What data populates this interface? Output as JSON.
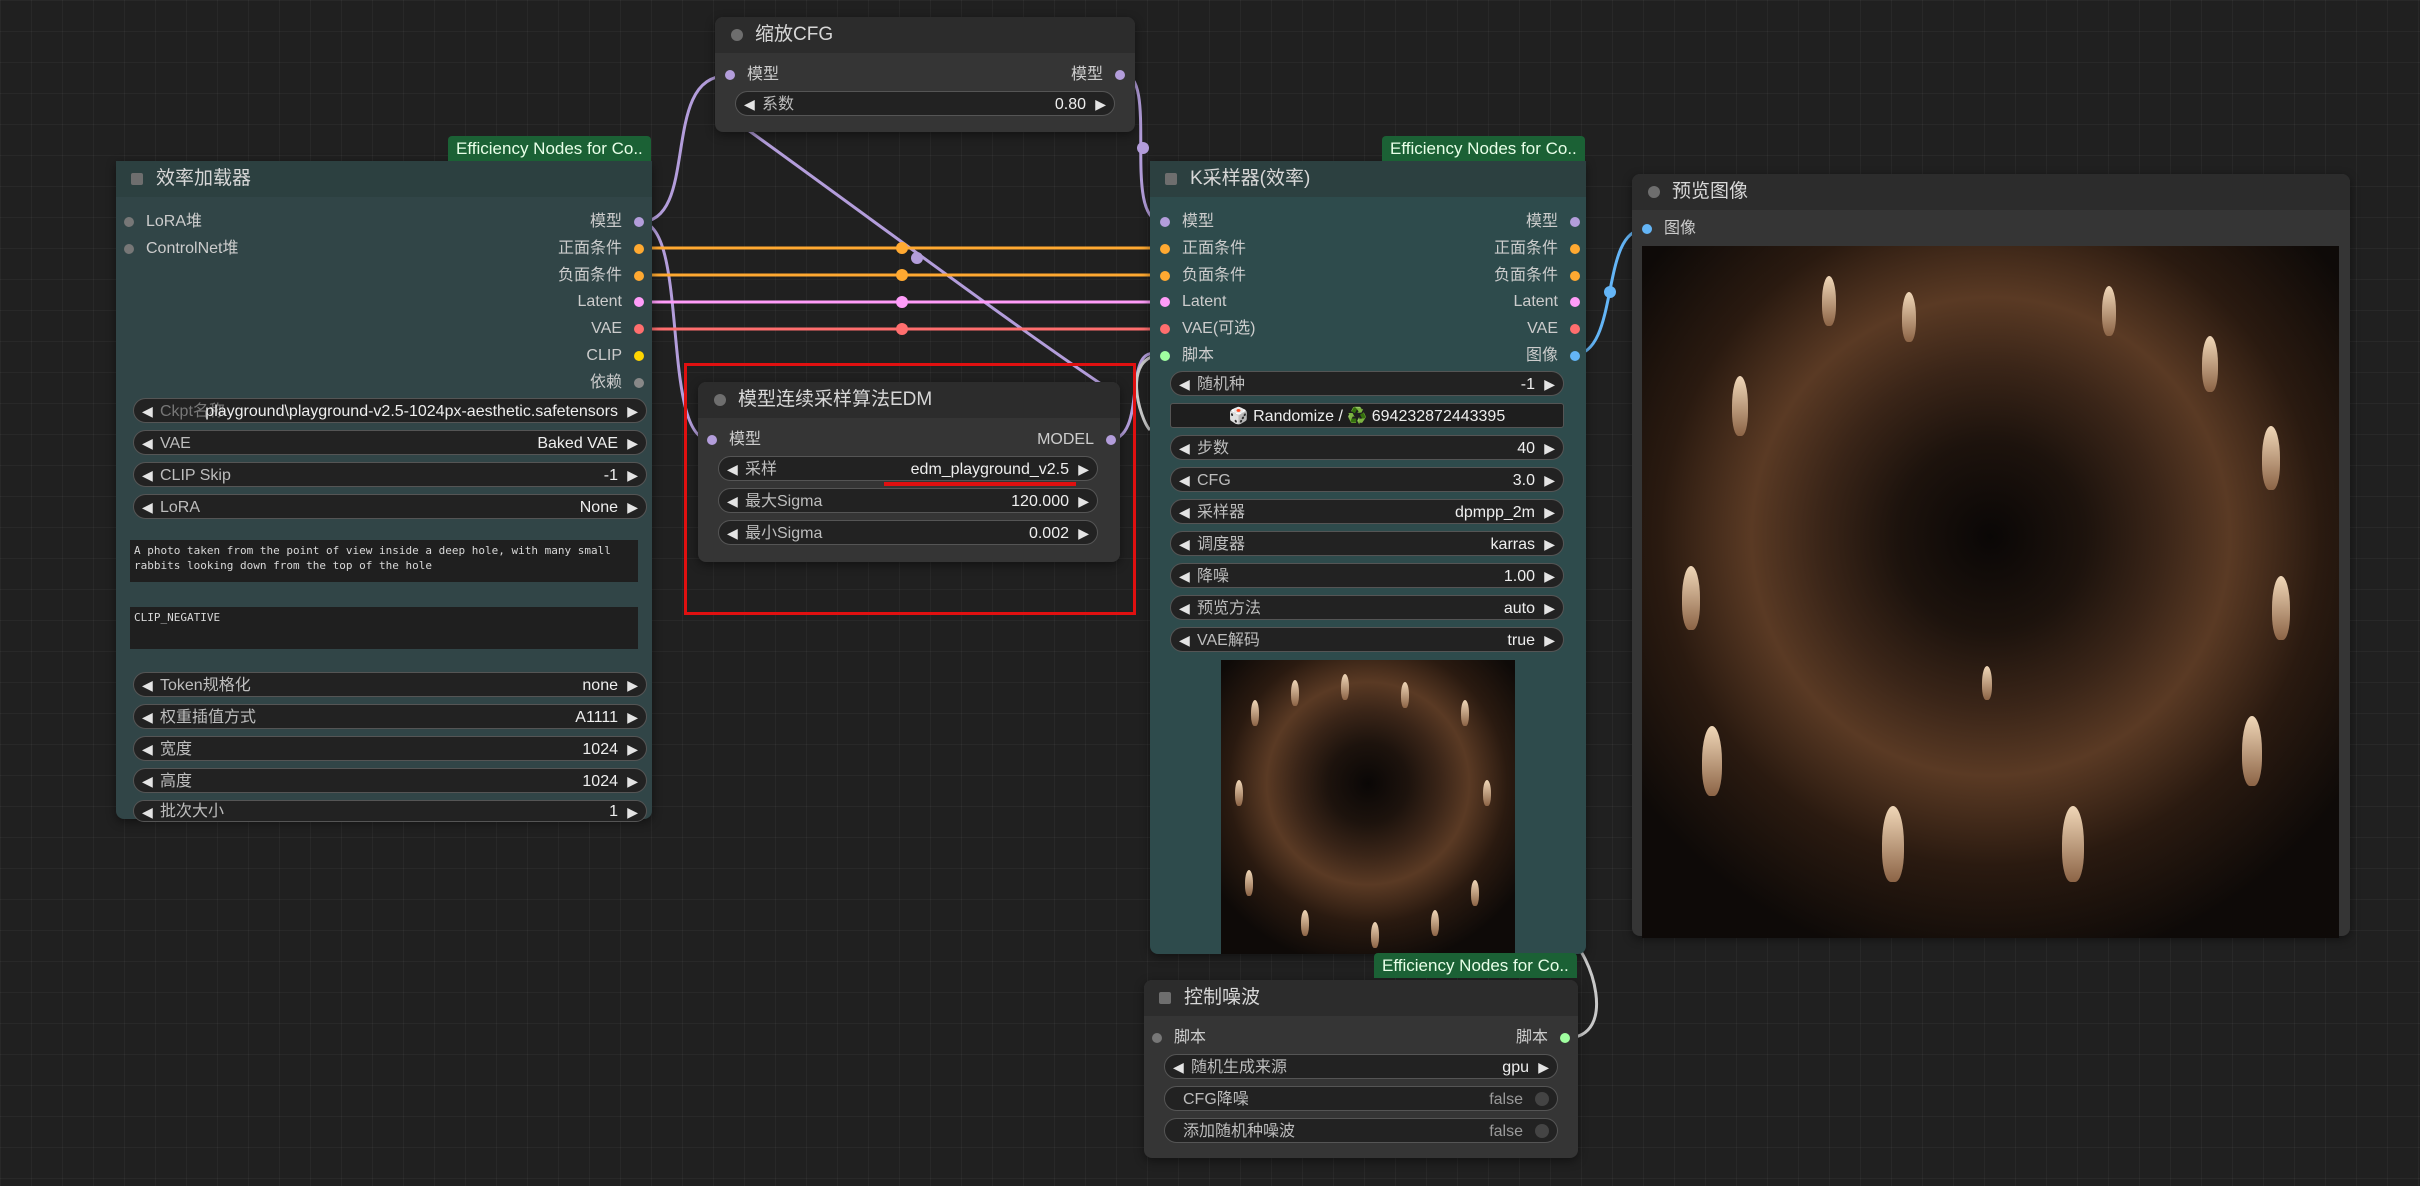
{
  "colors": {
    "model": "#b39ddb",
    "conditioning": "#ffa931",
    "latent": "#ff9cf9",
    "vae": "#ff6e6e",
    "clip": "#ffd500",
    "image": "#64b5f6",
    "script": "#a0ffa0",
    "dependency": "#888888",
    "badge": "#1b6135",
    "highlight": "#e01010"
  },
  "nodes": {
    "cfg_scale": {
      "title": "缩放CFG",
      "input_model": "模型",
      "output_model": "模型",
      "widgets": [
        {
          "label": "系数",
          "value": "0.80"
        }
      ]
    },
    "efficient_loader": {
      "badge": "Efficiency Nodes for Co..",
      "title": "效率加载器",
      "inputs": [
        "LoRA堆",
        "ControlNet堆"
      ],
      "outputs": [
        "模型",
        "正面条件",
        "负面条件",
        "Latent",
        "VAE",
        "CLIP",
        "依赖"
      ],
      "widgets": [
        {
          "label": "Ckpt名称",
          "value": "playground\\playground-v2.5-1024px-aesthetic.safetensors"
        },
        {
          "label": "VAE",
          "value": "Baked VAE"
        },
        {
          "label": "CLIP Skip",
          "value": "-1"
        },
        {
          "label": "LoRA",
          "value": "None"
        }
      ],
      "positive_prompt": "A photo taken from the point of view inside a deep hole, with many small rabbits looking down from the top of the hole",
      "negative_prompt": "CLIP_NEGATIVE",
      "widgets2": [
        {
          "label": "Token规格化",
          "value": "none"
        },
        {
          "label": "权重插值方式",
          "value": "A1111"
        },
        {
          "label": "宽度",
          "value": "1024"
        },
        {
          "label": "高度",
          "value": "1024"
        },
        {
          "label": "批次大小",
          "value": "1"
        }
      ]
    },
    "edm_sampling": {
      "title": "模型连续采样算法EDM",
      "input_model": "模型",
      "output_model": "MODEL",
      "widgets": [
        {
          "label": "采样",
          "value": "edm_playground_v2.5"
        },
        {
          "label": "最大Sigma",
          "value": "120.000"
        },
        {
          "label": "最小Sigma",
          "value": "0.002"
        }
      ]
    },
    "ksampler": {
      "badge": "Efficiency Nodes for Co..",
      "title": "K采样器(效率)",
      "inputs": [
        "模型",
        "正面条件",
        "负面条件",
        "Latent",
        "VAE(可选)",
        "脚本"
      ],
      "outputs": [
        "模型",
        "正面条件",
        "负面条件",
        "Latent",
        "VAE",
        "图像"
      ],
      "seed": {
        "label": "随机种",
        "value": "-1"
      },
      "randomize": "🎲 Randomize / ♻️ 694232872443395",
      "widgets": [
        {
          "label": "步数",
          "value": "40"
        },
        {
          "label": "CFG",
          "value": "3.0"
        },
        {
          "label": "采样器",
          "value": "dpmpp_2m"
        },
        {
          "label": "调度器",
          "value": "karras"
        },
        {
          "label": "降噪",
          "value": "1.00"
        },
        {
          "label": "预览方法",
          "value": "auto"
        },
        {
          "label": "VAE解码",
          "value": "true"
        }
      ]
    },
    "preview_image": {
      "title": "预览图像",
      "input": "图像"
    },
    "noise_control": {
      "badge": "Efficiency Nodes for Co..",
      "title": "控制噪波",
      "input": "脚本",
      "output": "脚本",
      "widgets": [
        {
          "label": "随机生成来源",
          "value": "gpu"
        }
      ],
      "toggles": [
        {
          "label": "CFG降噪",
          "value": "false"
        },
        {
          "label": "添加随机种噪波",
          "value": "false"
        }
      ]
    }
  }
}
